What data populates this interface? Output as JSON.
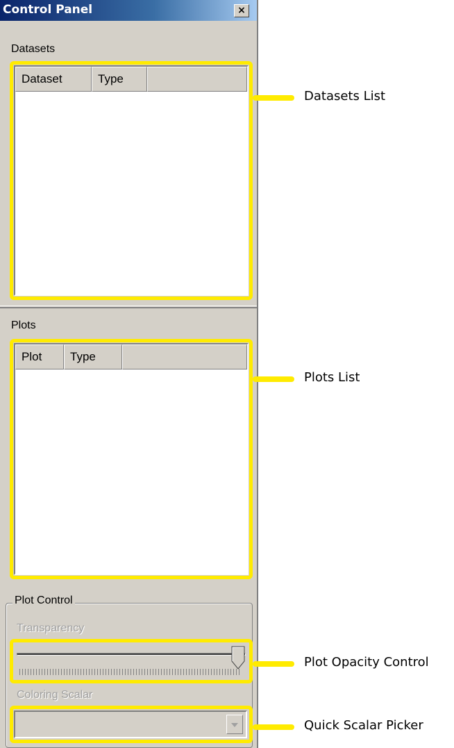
{
  "window": {
    "title": "Control Panel",
    "close_glyph": "×"
  },
  "datasets": {
    "label": "Datasets",
    "columns": [
      "Dataset",
      "Type",
      ""
    ],
    "rows": []
  },
  "plots": {
    "label": "Plots",
    "columns": [
      "Plot",
      "Type",
      ""
    ],
    "rows": []
  },
  "plot_control": {
    "label": "Plot Control",
    "transparency_label": "Transparency",
    "transparency_value": 1.0,
    "coloring_scalar_label": "Coloring Scalar",
    "coloring_scalar_value": ""
  },
  "callouts": {
    "datasets_list": "Datasets List",
    "plots_list": "Plots List",
    "plot_opacity": "Plot Opacity Control",
    "scalar_picker": "Quick Scalar Picker"
  },
  "colors": {
    "highlight": "#ffeb00",
    "panel_bg": "#d4d0c8",
    "title_bar": "#0a246a"
  },
  "icons": {
    "close": "close-icon",
    "dropdown": "chevron-down-icon",
    "slider_thumb": "slider-thumb-icon"
  }
}
